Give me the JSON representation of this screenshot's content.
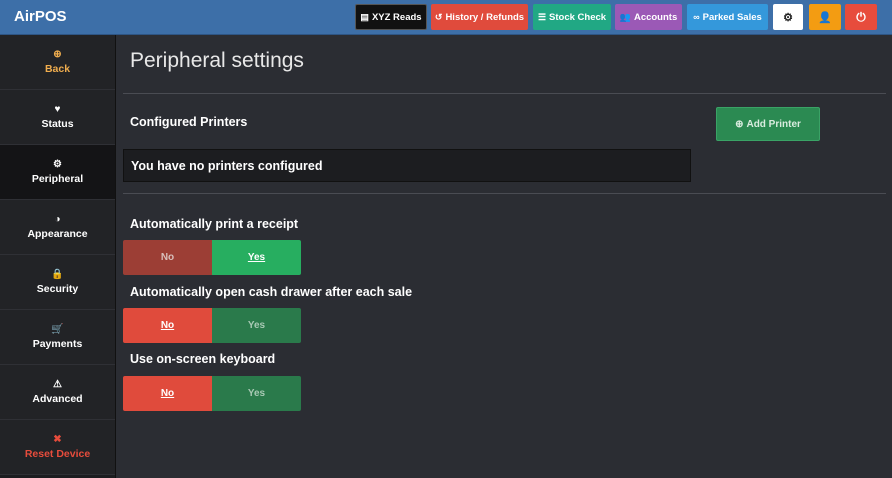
{
  "app": {
    "title": "AirPOS"
  },
  "toolbar": {
    "xyz_reads": {
      "label": "XYZ Reads",
      "icon": "report-icon"
    },
    "history_refunds": {
      "label": "History / Refunds",
      "icon": "history-icon"
    },
    "stock_check": {
      "label": "Stock Check",
      "icon": "list-icon"
    },
    "accounts": {
      "label": "Accounts",
      "icon": "users-icon"
    },
    "parked_sales": {
      "label": "Parked Sales",
      "icon": "binoculars-icon"
    },
    "settings_icon": "gear-icon",
    "user_icon": "user-icon",
    "power_icon": "power-icon"
  },
  "sidebar": {
    "items": [
      {
        "label": "Back",
        "icon": "plus-circle-icon"
      },
      {
        "label": "Status",
        "icon": "heartbeat-icon"
      },
      {
        "label": "Peripheral",
        "icon": "gear-icon"
      },
      {
        "label": "Appearance",
        "icon": "contrast-icon"
      },
      {
        "label": "Security",
        "icon": "lock-icon"
      },
      {
        "label": "Payments",
        "icon": "cart-icon"
      },
      {
        "label": "Advanced",
        "icon": "warning-icon"
      },
      {
        "label": "Reset Device",
        "icon": "close-icon"
      }
    ]
  },
  "main": {
    "title": "Peripheral settings",
    "printers": {
      "label": "Configured Printers",
      "add_button": "Add Printer",
      "empty_message": "You have no printers configured"
    },
    "settings": [
      {
        "label": "Automatically print a receipt",
        "no": "No",
        "yes": "Yes",
        "selected": "Yes"
      },
      {
        "label": "Automatically open cash drawer after each sale",
        "no": "No",
        "yes": "Yes",
        "selected": "No"
      },
      {
        "label": "Use on-screen keyboard",
        "no": "No",
        "yes": "Yes",
        "selected": "No"
      }
    ]
  },
  "colors": {
    "topbar": "#3d6fa8",
    "history": "#e04b3c",
    "stock": "#21a884",
    "accounts": "#9b59b6",
    "parked": "#3498db",
    "user": "#f39c12",
    "power": "#e74c3c",
    "back": "#f0ad4e",
    "reset": "#e74c3c"
  }
}
